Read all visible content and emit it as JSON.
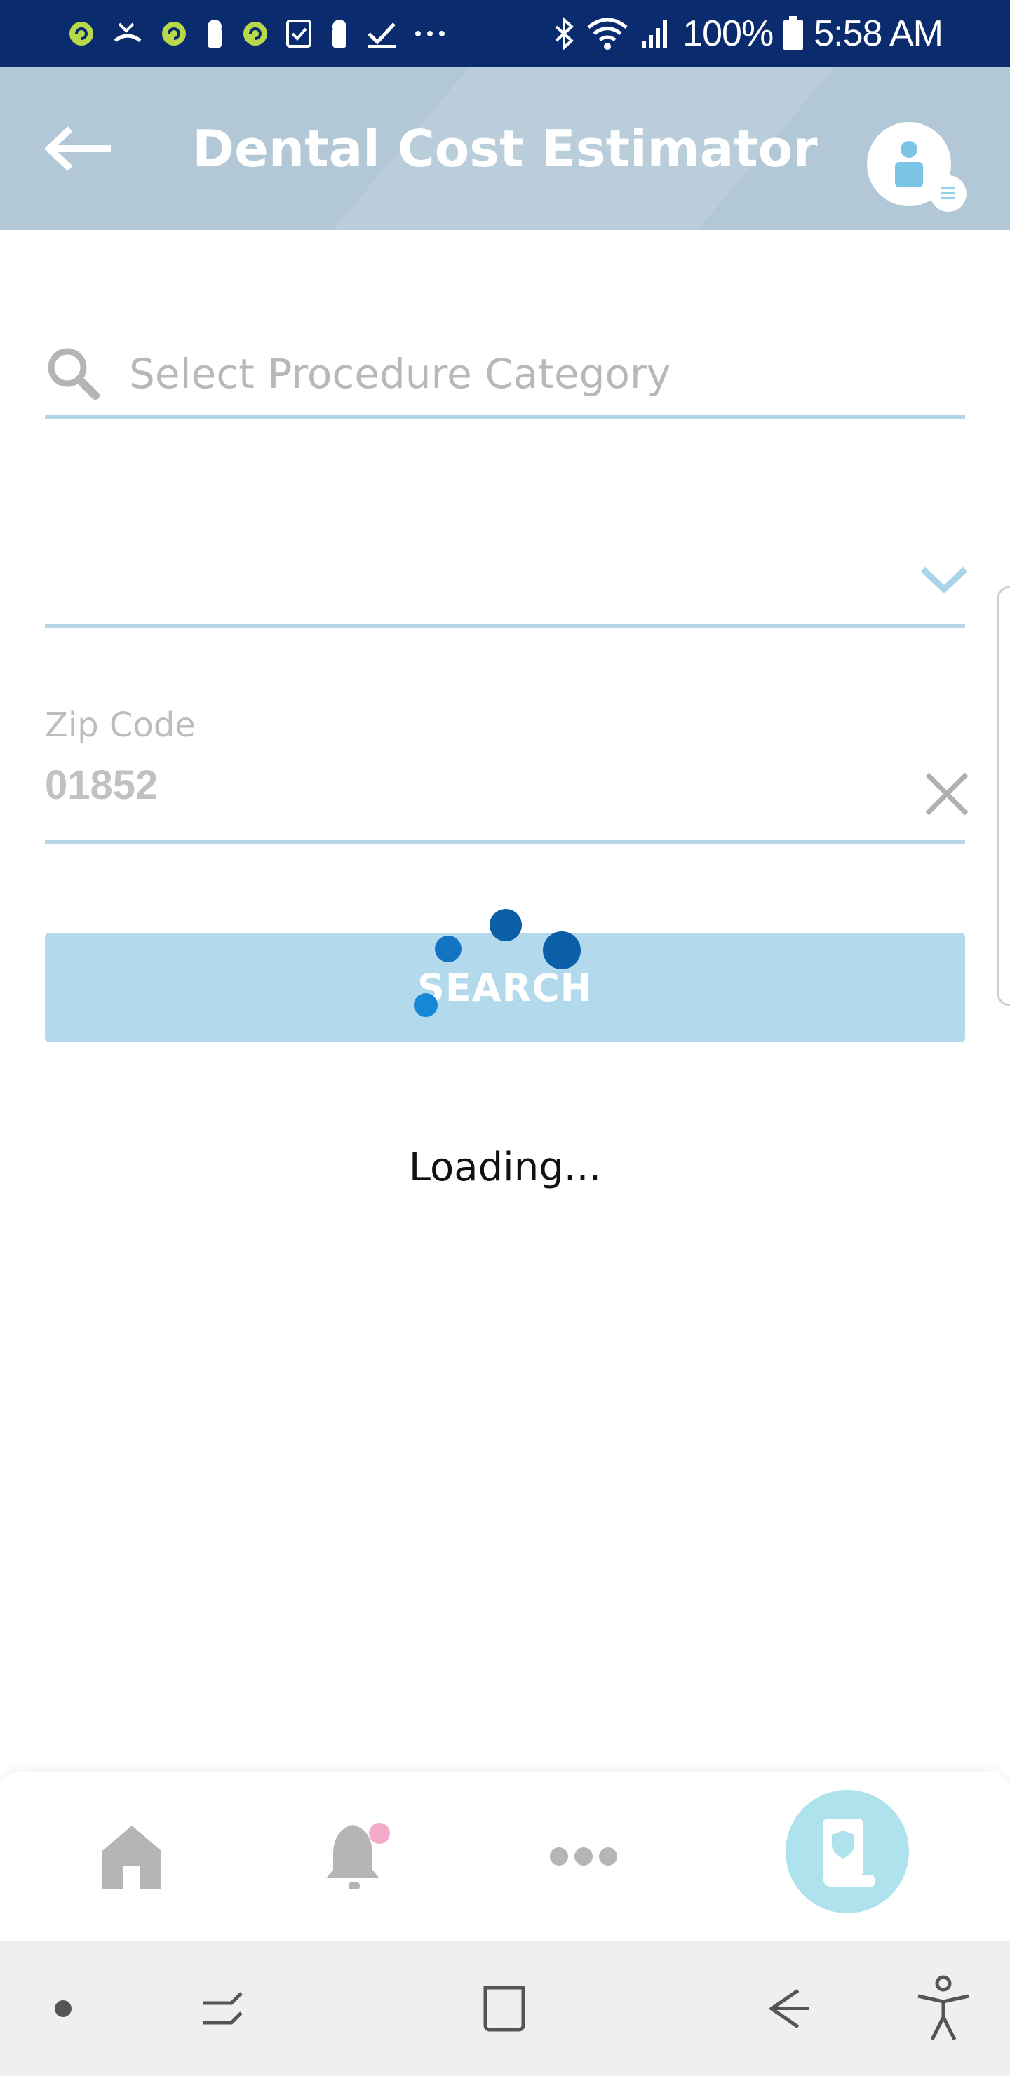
{
  "status_bar": {
    "battery": "100%",
    "time": "5:58 AM",
    "icons": [
      "app-notification-icon",
      "missed-call-icon",
      "app-notification-icon",
      "keyhole-icon",
      "app-notification-icon",
      "checklist-icon",
      "keyhole-icon",
      "check-icon",
      "more-dots-icon",
      "bluetooth-icon",
      "wifi-icon",
      "signal-icon",
      "battery-icon"
    ]
  },
  "header": {
    "title": "Dental Cost Estimator",
    "back_icon": "arrow-left-icon",
    "avatar_icon": "user-icon"
  },
  "form": {
    "procedure_search": {
      "placeholder": "Select Procedure Category",
      "value": ""
    },
    "dropdown": {
      "value": ""
    },
    "zip": {
      "label": "Zip Code",
      "value": "01852"
    },
    "search_button_label": "SEARCH"
  },
  "loading_text": "Loading...",
  "bottom_tabs": {
    "items": [
      "home-icon",
      "bell-icon",
      "more-icon",
      "claims-icon"
    ]
  },
  "system_nav": {
    "items": [
      "dot-icon",
      "recents-icon",
      "home-square-icon",
      "back-icon",
      "accessibility-icon"
    ]
  },
  "colors": {
    "status_bar": "#0a2c6e",
    "header": "#b3c8d6",
    "accent_light": "#b3d9ec",
    "spinner": "#1474c4",
    "claims_tab": "#aee2ec",
    "notification_dot": "#f4aacb"
  }
}
